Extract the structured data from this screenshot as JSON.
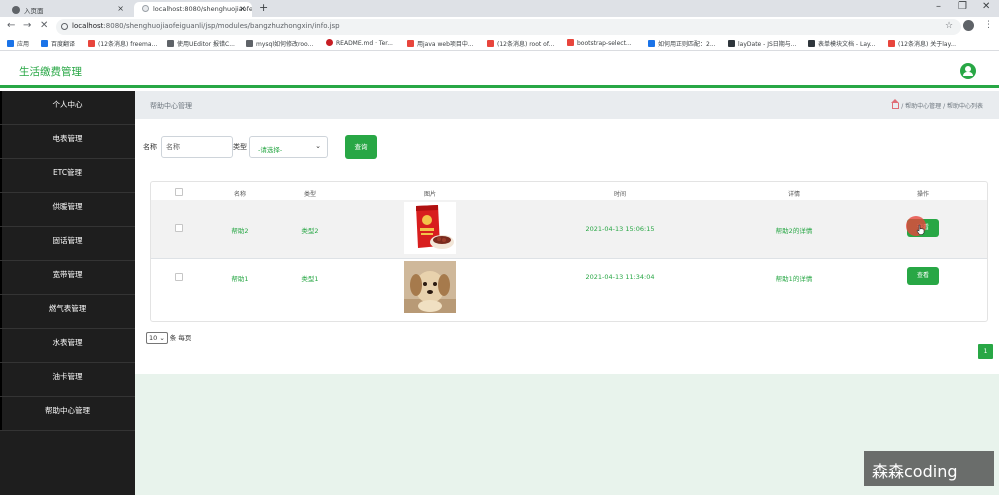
{
  "browser": {
    "tabs": [
      {
        "label": "入页面"
      },
      {
        "label": "localhost:8080/shenghuojiaofe"
      }
    ],
    "url_host": "localhost",
    "url_path": ":8080/shenghuojiaofeiguanli/jsp/modules/bangzhuzhongxin/info.jsp",
    "bookmarks": [
      {
        "label": "应用",
        "color": "#1a73e8"
      },
      {
        "label": "百度翻译",
        "color": "#1a73e8"
      },
      {
        "label": "(12条消息) freema...",
        "color": "#e8453c"
      },
      {
        "label": "使用UEditor 报错C...",
        "color": "#5f6368"
      },
      {
        "label": "mysql如何修改roo...",
        "color": "#5f6368"
      },
      {
        "label": "README.md · Ter...",
        "color": "#c71d23"
      },
      {
        "label": "用java web项目中...",
        "color": "#e8453c"
      },
      {
        "label": "(12条消息) root of...",
        "color": "#e8453c"
      },
      {
        "label": "bootstrap-select...",
        "color": "#e8453c"
      },
      {
        "label": "如何用正则匹配：2...",
        "color": "#1a73e8"
      },
      {
        "label": "layDate - JS日期与...",
        "color": "#2f363c"
      },
      {
        "label": "表单模块文档 - Lay...",
        "color": "#2f363c"
      },
      {
        "label": "(12条消息) 关于lay...",
        "color": "#e8453c"
      }
    ]
  },
  "app": {
    "title": "生活缴费管理",
    "accent": "#28a745"
  },
  "sidebar": {
    "items": [
      {
        "label": "个人中心"
      },
      {
        "label": "电表管理"
      },
      {
        "label": "ETC管理"
      },
      {
        "label": "供暖管理"
      },
      {
        "label": "固话管理"
      },
      {
        "label": "宽带管理"
      },
      {
        "label": "燃气表管理"
      },
      {
        "label": "水表管理"
      },
      {
        "label": "油卡管理"
      },
      {
        "label": "帮助中心管理"
      }
    ]
  },
  "breadcrumb": {
    "title": "帮助中心管理",
    "path": "/ 帮助中心管理 / 帮助中心列表"
  },
  "search": {
    "name_label": "名称",
    "name_placeholder": "名称",
    "type_label": "类型",
    "type_selected": "-请选择-",
    "query_button": "查询"
  },
  "table": {
    "headers": [
      "名称",
      "类型",
      "图片",
      "时间",
      "详情",
      "操作"
    ],
    "rows": [
      {
        "name": "帮助2",
        "type": "类型2",
        "image": "red-snack-bag",
        "time": "2021-04-13 15:06:15",
        "detail": "帮助2的详情",
        "action": "查看"
      },
      {
        "name": "帮助1",
        "type": "类型1",
        "image": "puppy-photo",
        "time": "2021-04-13 11:34:04",
        "detail": "帮助1的详情",
        "action": "查看"
      }
    ]
  },
  "pagination": {
    "page_size": "10",
    "page_size_suffix": "条 每页",
    "current_page": "1"
  },
  "watermark": "森森coding"
}
